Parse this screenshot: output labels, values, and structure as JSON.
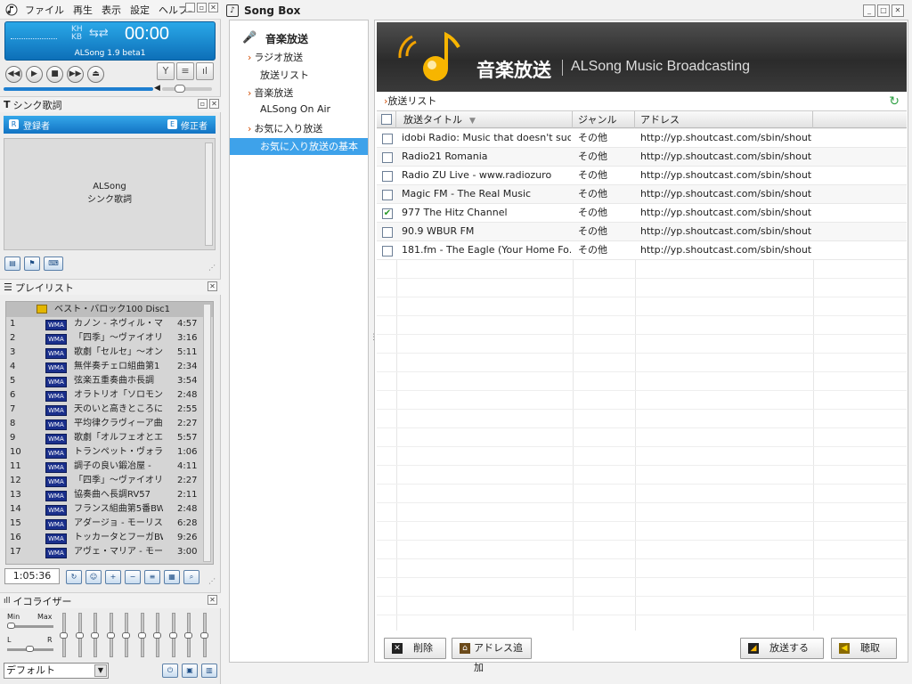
{
  "menubar": {
    "items": [
      "ファイル",
      "再生",
      "表示",
      "設定",
      "ヘルプ"
    ]
  },
  "player": {
    "kh": "KH",
    "kb": "KB",
    "x": "×",
    "time": "00:00",
    "version": "ALSong 1.9 beta1"
  },
  "lyrics": {
    "title": "シンク歌詞",
    "registrant": "登録者",
    "editor": "修正者",
    "placeholder_line1": "ALSong",
    "placeholder_line2": "シンク歌詞"
  },
  "playlist": {
    "title": "プレイリスト",
    "album": "ベスト・バロック100 Disc1",
    "badge": "WMA",
    "rows": [
      {
        "no": "1",
        "title": "カノン - ネヴィル・マリナ",
        "dur": "4:57"
      },
      {
        "no": "2",
        "title": "「四季」～ヴァイオリン協",
        "dur": "3:16"
      },
      {
        "no": "3",
        "title": "歌劇「セルセ」～オンブ",
        "dur": "5:11"
      },
      {
        "no": "4",
        "title": "無伴奏チェロ組曲第1",
        "dur": "2:34"
      },
      {
        "no": "5",
        "title": "弦楽五重奏曲ホ長調",
        "dur": "3:54"
      },
      {
        "no": "6",
        "title": "オラトリオ「ソロモン」～§",
        "dur": "2:48"
      },
      {
        "no": "7",
        "title": "天のいと高きところには",
        "dur": "2:55"
      },
      {
        "no": "8",
        "title": "平均律クラヴィーア曲§",
        "dur": "2:27"
      },
      {
        "no": "9",
        "title": "歌劇「オルフェオとエウリ",
        "dur": "5:57"
      },
      {
        "no": "10",
        "title": "トランペット・ヴォランタリ",
        "dur": "1:06"
      },
      {
        "no": "11",
        "title": "調子の良い鍛冶屋 -",
        "dur": "4:11"
      },
      {
        "no": "12",
        "title": "「四季」～ヴァイオリン協",
        "dur": "2:27"
      },
      {
        "no": "13",
        "title": "協奏曲へ長調RV57",
        "dur": "2:11"
      },
      {
        "no": "14",
        "title": "フランス組曲第5番BW",
        "dur": "2:48"
      },
      {
        "no": "15",
        "title": "アダージョ - モーリス・ア",
        "dur": "6:28"
      },
      {
        "no": "16",
        "title": "トッカータとフーガBWV",
        "dur": "9:26"
      },
      {
        "no": "17",
        "title": "アヴェ・マリア - モーリス・§",
        "dur": "3:00"
      }
    ],
    "total_time": "1:05:36"
  },
  "equalizer": {
    "title": "イコライザー",
    "min": "Min",
    "max": "Max",
    "l": "L",
    "r": "R",
    "band_levels": [
      0.5,
      0.5,
      0.5,
      0.5,
      0.5,
      0.5,
      0.5,
      0.5,
      0.5,
      0.5
    ],
    "preset": "デフォルト"
  },
  "songbox": {
    "title": "Song Box",
    "nav": {
      "root": "音楽放送",
      "items": [
        {
          "label": "ラジオ放送",
          "caret": true
        },
        {
          "label": "放送リスト",
          "caret": false
        },
        {
          "label": "音楽放送",
          "caret": true
        },
        {
          "label": "ALSong On Air",
          "caret": false
        },
        {
          "label": "お気に入り放送",
          "caret": true
        },
        {
          "label": "お気に入り放送の基本",
          "caret": false,
          "selected": true
        }
      ]
    },
    "banner": {
      "title_jp": "音楽放送",
      "title_en": "ALSong Music Broadcasting"
    },
    "breadcrumb": "放送リスト",
    "columns": [
      "放送タイトル",
      "ジャンル",
      "アドレス"
    ],
    "stations": [
      {
        "title": "idobi Radio: Music that doesn't suc...",
        "genre": "その他",
        "url": "http://yp.shoutcast.com/sbin/shout...",
        "checked": false
      },
      {
        "title": "Radio21 Romania",
        "genre": "その他",
        "url": "http://yp.shoutcast.com/sbin/shout...",
        "checked": false
      },
      {
        "title": "Radio ZU Live - www.radiozuro",
        "genre": "その他",
        "url": "http://yp.shoutcast.com/sbin/shout...",
        "checked": false
      },
      {
        "title": "Magic FM - The Real Music",
        "genre": "その他",
        "url": "http://yp.shoutcast.com/sbin/shout...",
        "checked": false
      },
      {
        "title": "977 The Hitz Channel",
        "genre": "その他",
        "url": "http://yp.shoutcast.com/sbin/shout...",
        "checked": true
      },
      {
        "title": "90.9 WBUR FM",
        "genre": "その他",
        "url": "http://yp.shoutcast.com/sbin/shout...",
        "checked": false
      },
      {
        "title": "181.fm - The Eagle (Your Home Fo...",
        "genre": "その他",
        "url": "http://yp.shoutcast.com/sbin/shout...",
        "checked": false
      }
    ],
    "buttons": {
      "delete": "削除",
      "add_address": "アドレス追加",
      "broadcast": "放送する",
      "listen": "聴取"
    }
  },
  "colors": {
    "accent": "#1b8fe0",
    "nav_selected": "#3ea2ea",
    "check": "#2a9a2a"
  }
}
